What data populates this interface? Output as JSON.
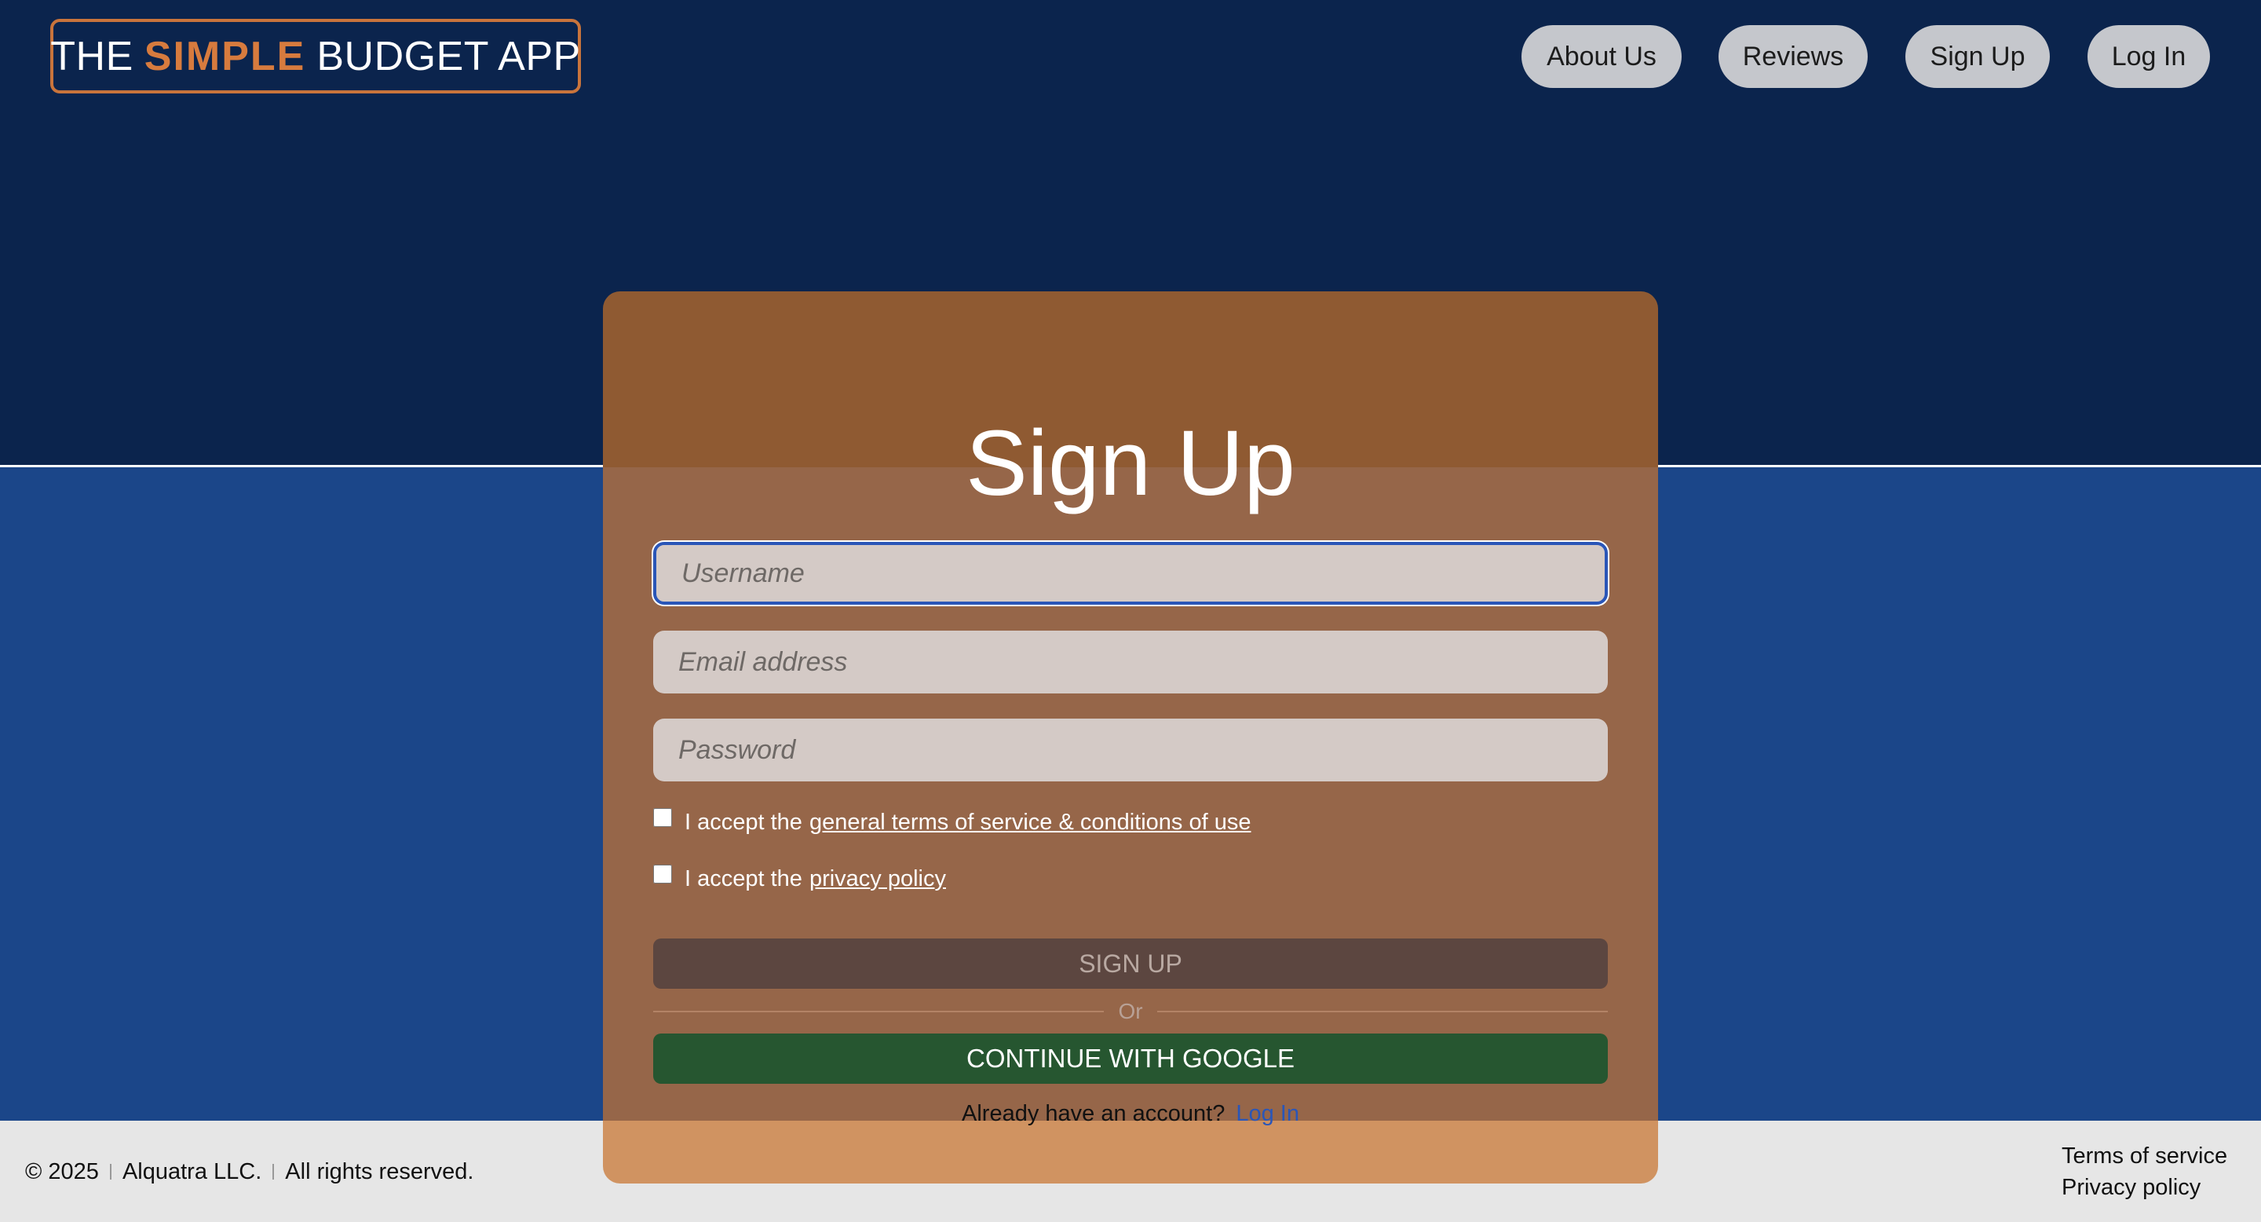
{
  "header": {
    "logo": {
      "prefix": "THE",
      "accent": "SIMPLE",
      "suffix": "BUDGET APP"
    },
    "nav": [
      {
        "label": "About Us"
      },
      {
        "label": "Reviews"
      },
      {
        "label": "Sign Up"
      },
      {
        "label": "Log In"
      }
    ]
  },
  "form": {
    "title": "Sign Up",
    "username": {
      "placeholder": "Username",
      "value": ""
    },
    "email": {
      "placeholder": "Email address",
      "value": ""
    },
    "password": {
      "placeholder": "Password",
      "value": ""
    },
    "terms": {
      "text": "I accept the",
      "link": "general terms of service & conditions of use"
    },
    "privacy": {
      "text": "I accept the",
      "link": "privacy policy"
    },
    "signup_label": "SIGN UP",
    "or_label": "Or",
    "google_label": "CONTINUE WITH GOOGLE",
    "already_text": "Already have an account?",
    "login_link": "Log In"
  },
  "footer": {
    "year": "© 2025",
    "company": "Alquatra LLC.",
    "rights": "All rights reserved.",
    "links": [
      "Terms of service",
      "Privacy policy"
    ]
  },
  "colors": {
    "header_bg": "#0b244d",
    "main_bg": "#1b4689",
    "accent": "#d77b3e",
    "card_bg": "#966649",
    "google_button": "#265630",
    "signup_button": "#5c4640",
    "footer_bg": "#e6e6e6"
  }
}
